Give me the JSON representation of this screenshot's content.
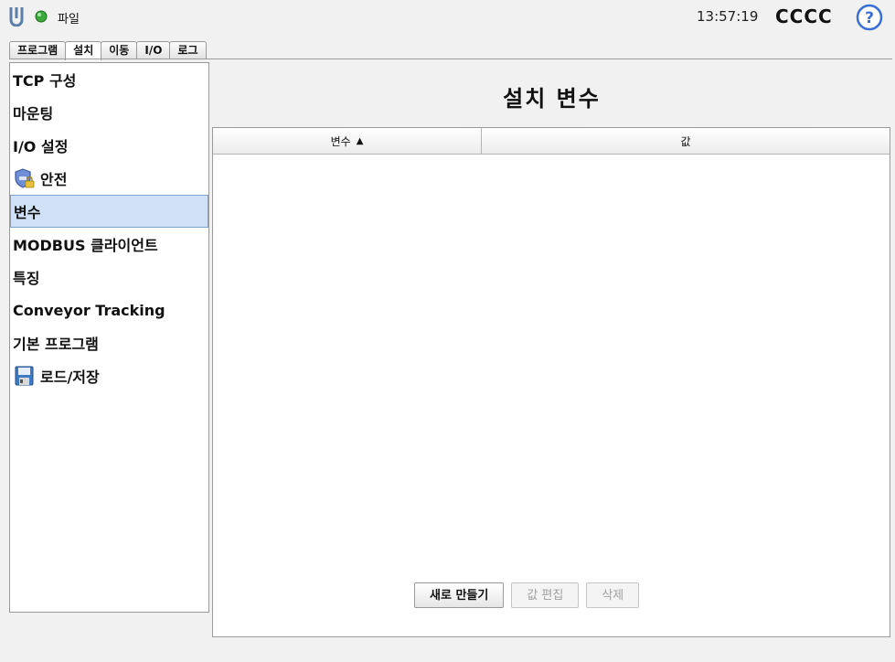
{
  "header": {
    "file_menu": "파일",
    "clock": "13:57:19",
    "robot_name": "CCCC",
    "status_color": "#3aa83a"
  },
  "tabs": [
    {
      "label": "프로그램"
    },
    {
      "label": "설치",
      "active": true
    },
    {
      "label": "이동"
    },
    {
      "label": "I/O"
    },
    {
      "label": "로그"
    }
  ],
  "sidebar": {
    "items": [
      {
        "label": "TCP 구성"
      },
      {
        "label": "마운팅"
      },
      {
        "label": "I/O 설정"
      },
      {
        "label": "안전",
        "icon": "safety-shield-lock-icon"
      },
      {
        "label": "변수",
        "selected": true
      },
      {
        "label": "MODBUS 클라이언트"
      },
      {
        "label": "특징"
      },
      {
        "label": "Conveyor Tracking"
      },
      {
        "label": "기본 프로그램"
      },
      {
        "label": "로드/저장",
        "icon": "floppy-disk-icon"
      }
    ]
  },
  "main": {
    "title": "설치 변수",
    "table": {
      "col_variable": "변수",
      "col_value": "값",
      "sort_icon": "sort-ascending-icon",
      "rows": []
    },
    "buttons": {
      "new": "새로 만들기",
      "edit_value": "값 편집",
      "delete": "삭제"
    }
  },
  "colors": {
    "selected_bg": "#cfe0f7",
    "help_icon": "#3b6fd4"
  }
}
